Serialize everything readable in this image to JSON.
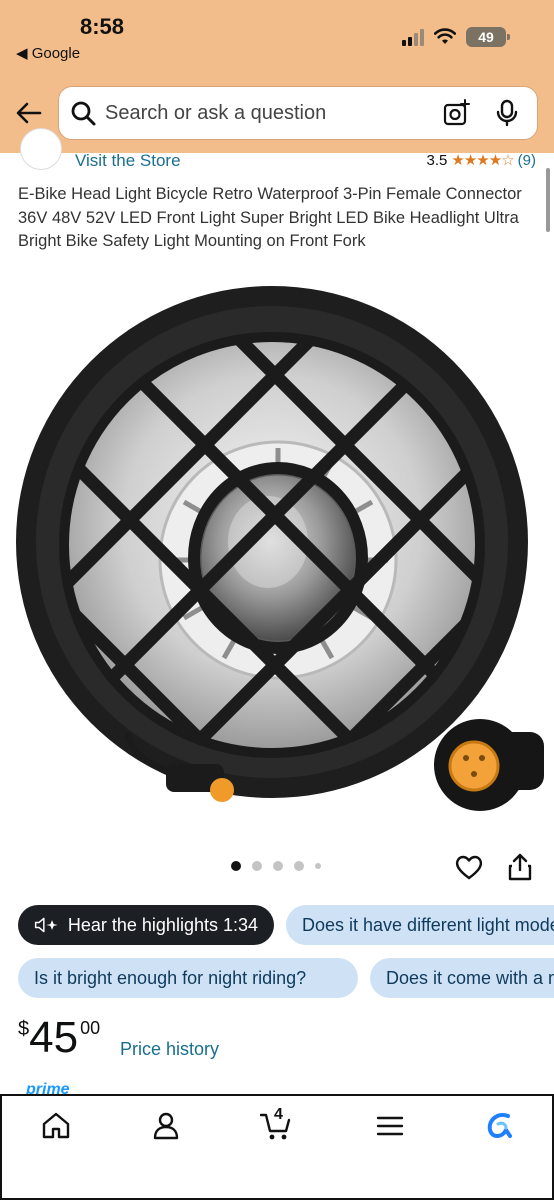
{
  "status_bar": {
    "time": "8:58",
    "back_app": "◀ Google",
    "battery": "49"
  },
  "search": {
    "placeholder": "Search or ask a question"
  },
  "store": {
    "link": "Visit the Store",
    "rating": "3.5",
    "stars": "★★★★☆",
    "rating_count": "(9)"
  },
  "product": {
    "title": "E-Bike Head Light Bicycle Retro Waterproof 3-Pin Female Connector 36V 48V 52V LED Front Light Super Bright LED Bike Headlight Ultra Bright Bike Safety Light Mounting on Front Fork",
    "image_count": 5,
    "active_image": 1
  },
  "chips": {
    "highlights": "Hear the highlights 1:34",
    "q1": "Does it have different light modes?",
    "q2": "Is it bright enough for night riding?",
    "q3": "Does it come with a mounting bracket?"
  },
  "price": {
    "symbol": "$",
    "whole": "45",
    "fraction": "00",
    "history": "Price history"
  },
  "prime": {
    "label": "prime"
  },
  "bottom_nav": {
    "cart_count": "4",
    "items": [
      "home-icon",
      "account-icon",
      "cart-icon",
      "menu-icon",
      "rufus-icon"
    ]
  },
  "colors": {
    "header_bg": "#f3bd8b",
    "link": "#1a6e8e",
    "star": "#de7921",
    "chip_light": "#cfe2f5",
    "chip_dark": "#1c1f24"
  }
}
